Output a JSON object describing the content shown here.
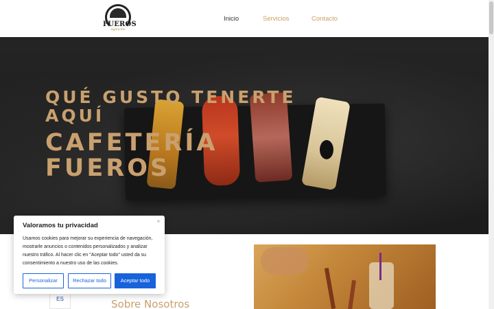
{
  "header": {
    "logo_text": "FUEROS",
    "logo_subtext": "Agoncillo",
    "nav": [
      {
        "label": "Inicio"
      },
      {
        "label": "Servicios"
      },
      {
        "label": "Contacto"
      }
    ],
    "active_color": "#333333",
    "accent_color": "#c9a063"
  },
  "hero": {
    "tagline": "QUÉ GUSTO TENERTE AQUÍ",
    "title": "CAFETERÍA FUEROS",
    "text_color": "#c9a06e"
  },
  "main": {
    "section_title": "Sobre Nosotros"
  },
  "language_switcher": {
    "current": "ES"
  },
  "cookie_banner": {
    "title": "Valoramos tu privacidad",
    "text": "Usamos cookies para mejorar su experiencia de navegación, mostrarle anuncios o contenidos personalizados y analizar nuestro tráfico. Al hacer clic en \"Aceptar todo\" usted da su consentimiento a nuestro uso de las cookies.",
    "close_icon": "×",
    "buttons": {
      "customize": "Personalizar",
      "reject": "Rechazar todo",
      "accept": "Aceptar todo"
    },
    "button_color": "#1863dc"
  }
}
